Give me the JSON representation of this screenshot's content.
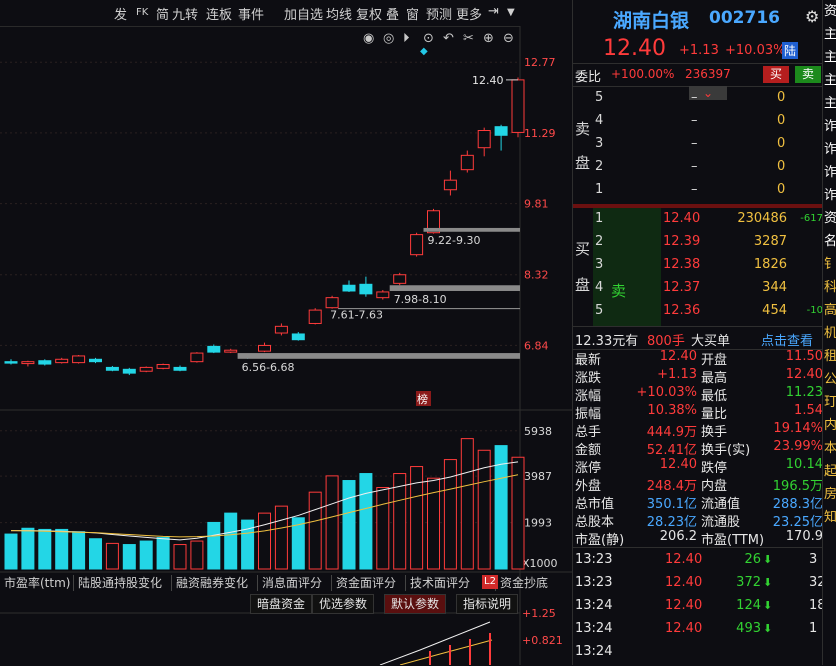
{
  "toolbar": {
    "items": [
      "发",
      "FK",
      "简",
      "九转",
      "连板",
      "事件",
      "加自选",
      "均线",
      "复权",
      "叠",
      "窗",
      "预测",
      "更多"
    ],
    "pin_icon": "pin-right-icon",
    "menu_icon": "chevron-down-icon"
  },
  "chart_tools": [
    "eye-icon",
    "eye-icon",
    "play-icon",
    "timer-icon",
    "undo-icon",
    "scissors-icon",
    "zoom-in-icon",
    "zoom-out-icon"
  ],
  "chart_data": [
    {
      "type": "candlestick",
      "price_axis_labels": [
        "12.77",
        "11.29",
        "9.81",
        "8.32",
        "6.84"
      ],
      "ylim": [
        6.2,
        12.9
      ],
      "high_label": "12.40",
      "gap_labels": [
        "9.22-9.30",
        "7.98-8.10",
        "7.61-7.63",
        "6.56-6.68"
      ],
      "gaps": [
        [
          9.22,
          9.3
        ],
        [
          7.98,
          8.1
        ],
        [
          7.61,
          7.63
        ],
        [
          6.56,
          6.68
        ]
      ],
      "badge": "榜",
      "candles": [
        [
          6.5,
          6.47,
          6.55,
          6.44
        ],
        [
          6.46,
          6.5,
          6.52,
          6.4
        ],
        [
          6.52,
          6.45,
          6.55,
          6.42
        ],
        [
          6.48,
          6.55,
          6.58,
          6.46
        ],
        [
          6.48,
          6.62,
          6.64,
          6.46
        ],
        [
          6.55,
          6.5,
          6.58,
          6.47
        ],
        [
          6.38,
          6.32,
          6.41,
          6.3
        ],
        [
          6.34,
          6.26,
          6.37,
          6.22
        ],
        [
          6.3,
          6.38,
          6.4,
          6.28
        ],
        [
          6.36,
          6.44,
          6.46,
          6.34
        ],
        [
          6.38,
          6.32,
          6.42,
          6.3
        ],
        [
          6.5,
          6.68,
          6.7,
          6.48
        ],
        [
          6.82,
          6.7,
          6.86,
          6.68
        ],
        [
          6.7,
          6.74,
          6.77,
          6.68
        ],
        [
          6.62,
          6.58,
          6.66,
          6.56
        ],
        [
          6.72,
          6.84,
          6.9,
          6.7
        ],
        [
          7.1,
          7.24,
          7.3,
          7.05
        ],
        [
          7.08,
          6.96,
          7.12,
          6.94
        ],
        [
          7.3,
          7.58,
          7.62,
          7.28
        ],
        [
          7.63,
          7.84,
          7.88,
          7.61
        ],
        [
          8.1,
          7.98,
          8.2,
          7.96
        ],
        [
          8.12,
          7.92,
          8.28,
          7.86
        ],
        [
          7.84,
          7.96,
          8.0,
          7.8
        ],
        [
          8.14,
          8.32,
          8.36,
          8.1
        ],
        [
          8.74,
          9.16,
          9.2,
          8.7
        ],
        [
          9.2,
          9.66,
          9.7,
          9.18
        ],
        [
          10.1,
          10.3,
          10.5,
          9.98
        ],
        [
          10.52,
          10.82,
          10.92,
          10.46
        ],
        [
          10.98,
          11.34,
          11.4,
          10.8
        ],
        [
          11.42,
          11.24,
          11.46,
          10.92
        ],
        [
          11.3,
          12.4,
          12.45,
          11.2
        ]
      ],
      "volume_axis_labels": [
        "5938",
        "3987",
        "1993"
      ],
      "volume_unit": "X1000",
      "volumes": [
        1500,
        1750,
        1700,
        1700,
        1600,
        1300,
        1100,
        1050,
        1200,
        1350,
        1050,
        1200,
        2000,
        2400,
        2100,
        2400,
        2700,
        2200,
        3300,
        4000,
        3800,
        4100,
        3500,
        4100,
        4400,
        3900,
        4700,
        5600,
        5100,
        5300,
        4800
      ],
      "volume_colors": [
        "cyan",
        "cyan",
        "cyan",
        "cyan",
        "cyan",
        "cyan",
        "red",
        "cyan",
        "cyan",
        "cyan",
        "red",
        "red",
        "cyan",
        "cyan",
        "cyan",
        "red",
        "red",
        "cyan",
        "red",
        "red",
        "cyan",
        "cyan",
        "red",
        "red",
        "red",
        "red",
        "red",
        "red",
        "red",
        "cyan",
        "red"
      ],
      "ma_volume": [
        1650,
        1650,
        1640,
        1620,
        1590,
        1550,
        1480,
        1420,
        1360,
        1300,
        1250,
        1320,
        1450,
        1580,
        1720,
        1900,
        2100,
        2300,
        2550,
        2800,
        3050,
        3250,
        3400,
        3550,
        3700,
        3800,
        3950,
        4150,
        4350,
        4500,
        4600
      ],
      "ma_volume_2": [
        1650,
        1640,
        1620,
        1600,
        1580,
        1560,
        1520,
        1480,
        1440,
        1400,
        1380,
        1390,
        1420,
        1470,
        1540,
        1640,
        1760,
        1900,
        2060,
        2240,
        2420,
        2600,
        2780,
        2950,
        3120,
        3280,
        3430,
        3590,
        3750,
        3900,
        4050
      ]
    }
  ],
  "tabs": [
    "市盈率(ttm)",
    "陆股通持股变化",
    "融资融券变化",
    "消息面评分",
    "资金面评分",
    "技术面评分",
    "资金抄底"
  ],
  "tab_badge": "L2",
  "sub_buttons": [
    "暗盘资金",
    "优选参数",
    "默认参数",
    "指标说明"
  ],
  "indicator_axis_labels": [
    "+1.25",
    "+0.821"
  ],
  "stock": {
    "name": "湖南白银",
    "code": "002716",
    "price": "12.40",
    "change": "+1.13",
    "change_pct": "+10.03%",
    "tag": "陆",
    "settings_icon": "gear-icon",
    "webi_label": "委比",
    "webi_pct": "+100.00%",
    "webi_diff": "236397",
    "buy_btn": "买",
    "sell_btn": "卖"
  },
  "ask_side_label": [
    "卖",
    "盘"
  ],
  "asks": [
    {
      "level": "5",
      "price": "–",
      "vol": "0"
    },
    {
      "level": "4",
      "price": "–",
      "vol": "0"
    },
    {
      "level": "3",
      "price": "–",
      "vol": "0"
    },
    {
      "level": "2",
      "price": "–",
      "vol": "0"
    },
    {
      "level": "1",
      "price": "–",
      "vol": "0"
    }
  ],
  "bid_side_label": [
    "买",
    "盘"
  ],
  "bids": [
    {
      "level": "1",
      "price": "12.40",
      "vol": "230486",
      "delta": "-617"
    },
    {
      "level": "2",
      "price": "12.39",
      "vol": "3287",
      "delta": ""
    },
    {
      "level": "3",
      "price": "12.38",
      "vol": "1826",
      "delta": ""
    },
    {
      "level": "4",
      "price": "12.37",
      "vol": "344",
      "delta": ""
    },
    {
      "level": "5",
      "price": "12.36",
      "vol": "454",
      "delta": "-10"
    }
  ],
  "bid_sell_tag": "卖",
  "bigorder": {
    "amount": "12.33元有",
    "hand": "800手",
    "label": "大买单",
    "link": "点击查看"
  },
  "stats": [
    [
      "最新",
      "12.40",
      "开盘",
      "11.50"
    ],
    [
      "涨跌",
      "+1.13",
      "最高",
      "12.40"
    ],
    [
      "涨幅",
      "+10.03%",
      "最低",
      "11.23"
    ],
    [
      "振幅",
      "10.38%",
      "量比",
      "1.54"
    ],
    [
      "总手",
      "444.9万",
      "换手",
      "19.14%"
    ],
    [
      "金额",
      "52.41亿",
      "换手(实)",
      "23.99%"
    ],
    [
      "涨停",
      "12.40",
      "跌停",
      "10.14"
    ],
    [
      "外盘",
      "248.4万",
      "内盘",
      "196.5万"
    ],
    [
      "总市值",
      "350.1亿",
      "流通值",
      "288.3亿"
    ],
    [
      "总股本",
      "28.23亿",
      "流通股",
      "23.25亿"
    ],
    [
      "市盈(静)",
      "206.2",
      "市盈(TTM)",
      "170.9"
    ]
  ],
  "ticks": [
    {
      "time": "13:23",
      "price": "12.40",
      "vol": "26",
      "trail": "3"
    },
    {
      "time": "13:23",
      "price": "12.40",
      "vol": "372",
      "trail": "32"
    },
    {
      "time": "13:24",
      "price": "12.40",
      "vol": "124",
      "trail": "18"
    },
    {
      "time": "13:24",
      "price": "12.40",
      "vol": "493",
      "trail": "1"
    },
    {
      "time": "13:24",
      "price": "",
      "vol": "",
      "trail": ""
    }
  ],
  "edge_chars": [
    "资",
    "主",
    "主",
    "主",
    "主",
    "诈",
    "诈",
    "诈",
    "诈",
    "资",
    "名",
    "钅",
    "科",
    "高",
    "机",
    "租",
    "公",
    "玎",
    "内",
    "本",
    "起",
    "房",
    "知"
  ]
}
